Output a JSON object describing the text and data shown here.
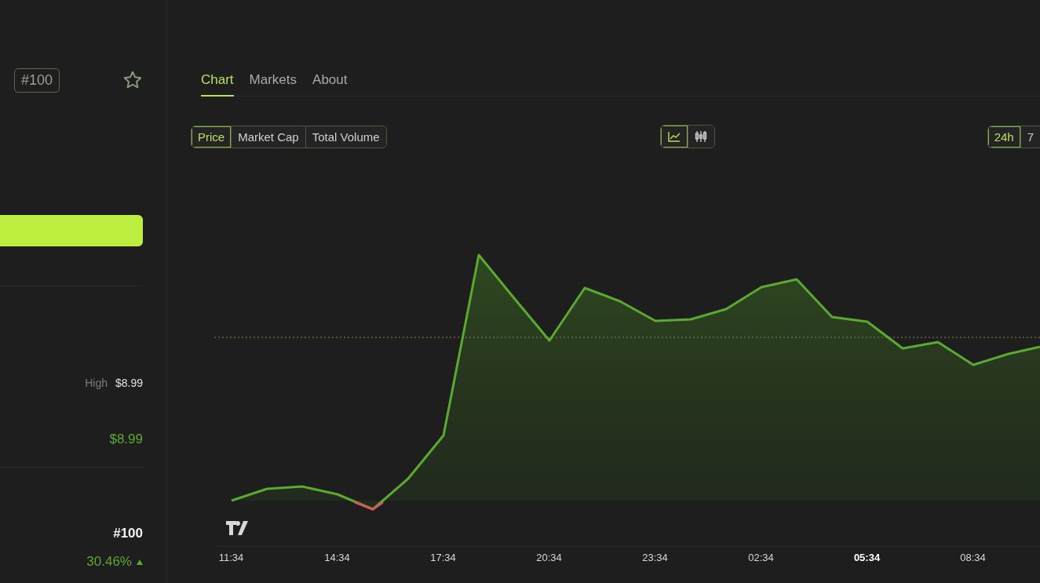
{
  "header": {
    "rank_badge": "#100",
    "favorite": false
  },
  "stats": {
    "high_label": "High",
    "high_value": "$8.99",
    "price": "$8.99",
    "rank": "#100",
    "change": "30.46%",
    "change_up": true
  },
  "tabs": [
    {
      "label": "Chart",
      "selected": true
    },
    {
      "label": "Markets",
      "selected": false
    },
    {
      "label": "About",
      "selected": false
    }
  ],
  "metric_buttons": [
    {
      "label": "Price",
      "selected": true
    },
    {
      "label": "Market Cap",
      "selected": false
    },
    {
      "label": "Total Volume",
      "selected": false
    }
  ],
  "chart_types": [
    {
      "kind": "line",
      "selected": true
    },
    {
      "kind": "candles",
      "selected": false
    }
  ],
  "ranges": [
    {
      "label": "24h",
      "selected": true
    },
    {
      "label": "7",
      "selected": false
    }
  ],
  "time_labels": [
    {
      "label": "11:34",
      "bold": false
    },
    {
      "label": "14:34",
      "bold": false
    },
    {
      "label": "17:34",
      "bold": false
    },
    {
      "label": "20:34",
      "bold": false
    },
    {
      "label": "23:34",
      "bold": false
    },
    {
      "label": "02:34",
      "bold": false
    },
    {
      "label": "05:34",
      "bold": true
    },
    {
      "label": "08:34",
      "bold": false
    }
  ]
}
